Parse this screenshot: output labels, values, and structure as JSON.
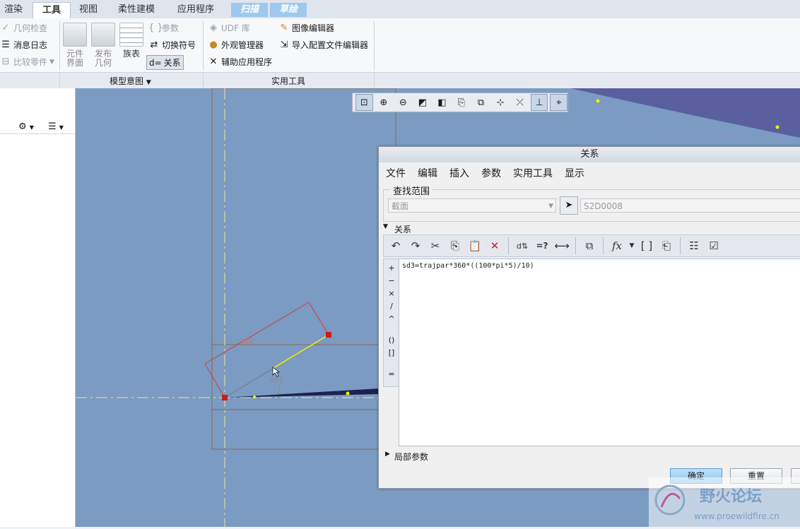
{
  "tabs": [
    {
      "label": "渲染"
    },
    {
      "label": "工具"
    },
    {
      "label": "视图"
    },
    {
      "label": "柔性建模"
    },
    {
      "label": "应用程序"
    },
    {
      "label": "扫描"
    },
    {
      "label": "草绘"
    }
  ],
  "ribbon": {
    "geometry_check": "几何检查",
    "message_log": "消息日志",
    "compare_parts": "比较零件",
    "component_interface": "元件\n界面",
    "publish_geometry": "发布\n几何",
    "family_table": "族表",
    "parameters": "参数",
    "switch_symbols": "切换符号",
    "relations": "关系",
    "relations_prefix": "d=",
    "udf_library": "UDF 库",
    "appearance_manager": "外观管理器",
    "aux_applications": "辅助应用程序",
    "image_editor": "图像编辑器",
    "import_config_editor": "导入配置文件编辑器",
    "group_model_intent": "模型意图",
    "group_utilities": "实用工具"
  },
  "canvas": {
    "dim_sd5": "sd5",
    "dim_sd3": "sd3"
  },
  "dialog": {
    "title": "关系",
    "menus": [
      "文件",
      "编辑",
      "插入",
      "参数",
      "实用工具",
      "显示"
    ],
    "scope_label": "查找范围",
    "scope_value": "截面",
    "scope_item": "S2D0008",
    "relations_section": "关系",
    "relation_text": "sd3=trajpar*360*((100*pi*5)/10)",
    "operators": [
      "+",
      "−",
      "×",
      "/",
      "^",
      "()",
      "[]",
      "="
    ],
    "local_params": "局部参数",
    "ok": "确定",
    "reset": "重置"
  },
  "watermark": {
    "name": "野火论坛",
    "url": "www.proewildfire.cn"
  },
  "colors": {
    "canvas_bg": "#7b9bc2",
    "ok_button": "#8ec6ef",
    "dimension_red": "#d23b3b",
    "yellow_line": "#f2f200",
    "sweep_surface": "#5a5fa0"
  }
}
